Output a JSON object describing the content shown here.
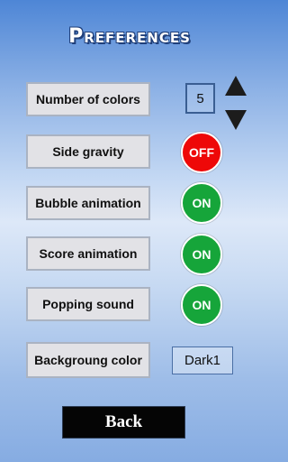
{
  "title": "Preferences",
  "number_of_colors": {
    "label": "Number of colors",
    "value": "5"
  },
  "side_gravity": {
    "label": "Side gravity",
    "state": "OFF"
  },
  "bubble_animation": {
    "label": "Bubble animation",
    "state": "ON"
  },
  "score_animation": {
    "label": "Score animation",
    "state": "ON"
  },
  "popping_sound": {
    "label": "Popping sound",
    "state": "ON"
  },
  "background_color": {
    "label": "Backgroung color",
    "value": "Dark1"
  },
  "back_button": "Back",
  "icons": {
    "increase": "triangle-up-icon",
    "decrease": "triangle-down-icon"
  },
  "colors": {
    "on": "#16a53a",
    "off": "#ee0808"
  }
}
